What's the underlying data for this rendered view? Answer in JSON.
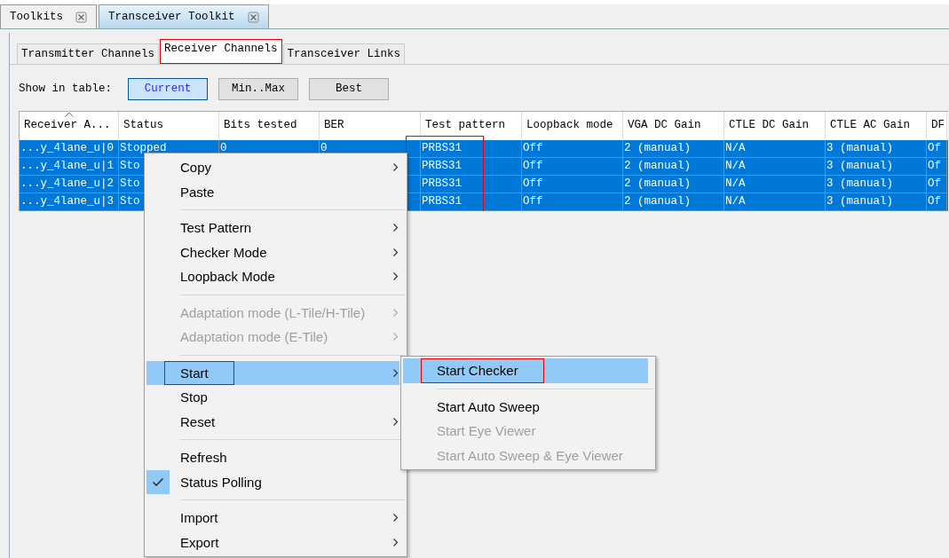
{
  "window_tabs": [
    {
      "label": "Toolkits",
      "selected": false
    },
    {
      "label": "Transceiver Toolkit",
      "selected": true
    }
  ],
  "tabs": [
    {
      "label": "Transmitter Channels",
      "selected": false,
      "annotated": false
    },
    {
      "label": "Receiver Channels",
      "selected": true,
      "annotated": true
    },
    {
      "label": "Transceiver Links",
      "selected": false,
      "annotated": false
    }
  ],
  "show_in_table": {
    "label": "Show in table:",
    "buttons": [
      {
        "label": "Current",
        "selected": true
      },
      {
        "label": "Min..Max",
        "selected": false
      },
      {
        "label": "Best",
        "selected": false
      }
    ]
  },
  "table": {
    "columns": [
      {
        "label": "Receiver A...",
        "sorted": true,
        "annotated": false
      },
      {
        "label": "Status",
        "sorted": false,
        "annotated": false
      },
      {
        "label": "Bits tested",
        "sorted": false,
        "annotated": false
      },
      {
        "label": "BER",
        "sorted": false,
        "annotated": false
      },
      {
        "label": "Test pattern",
        "sorted": false,
        "annotated": true
      },
      {
        "label": "Loopback mode",
        "sorted": false,
        "annotated": false
      },
      {
        "label": "VGA DC Gain",
        "sorted": false,
        "annotated": false
      },
      {
        "label": "CTLE DC Gain",
        "sorted": false,
        "annotated": false
      },
      {
        "label": "CTLE AC Gain",
        "sorted": false,
        "annotated": false
      },
      {
        "label": "DF",
        "sorted": false,
        "annotated": false
      }
    ],
    "rows": [
      {
        "selected": true,
        "cells": [
          "...y_4lane_u|0",
          "Stopped",
          "0",
          "0",
          "PRBS31",
          "Off",
          "2 (manual)",
          "N/A",
          "3 (manual)",
          "Of"
        ]
      },
      {
        "selected": true,
        "cells": [
          "...y_4lane_u|1",
          "Sto",
          null,
          null,
          "PRBS31",
          "Off",
          "2 (manual)",
          "N/A",
          "3 (manual)",
          "Of"
        ]
      },
      {
        "selected": true,
        "cells": [
          "...y_4lane_u|2",
          "Sto",
          null,
          null,
          "PRBS31",
          "Off",
          "2 (manual)",
          "N/A",
          "3 (manual)",
          "Of"
        ]
      },
      {
        "selected": true,
        "cells": [
          "...y_4lane_u|3",
          "Sto",
          null,
          null,
          "PRBS31",
          "Off",
          "2 (manual)",
          "N/A",
          "3 (manual)",
          "Of"
        ]
      }
    ]
  },
  "context_menu": {
    "items": [
      {
        "kind": "item",
        "label": "Copy",
        "submenu": true,
        "disabled": false,
        "checked": false,
        "selected": false,
        "annotated": false
      },
      {
        "kind": "item",
        "label": "Paste",
        "submenu": false,
        "disabled": false,
        "checked": false,
        "selected": false,
        "annotated": false
      },
      {
        "kind": "separator"
      },
      {
        "kind": "item",
        "label": "Test Pattern",
        "submenu": true,
        "disabled": false,
        "checked": false,
        "selected": false,
        "annotated": false
      },
      {
        "kind": "item",
        "label": "Checker Mode",
        "submenu": true,
        "disabled": false,
        "checked": false,
        "selected": false,
        "annotated": false
      },
      {
        "kind": "item",
        "label": "Loopback Mode",
        "submenu": true,
        "disabled": false,
        "checked": false,
        "selected": false,
        "annotated": false
      },
      {
        "kind": "separator"
      },
      {
        "kind": "item",
        "label": "Adaptation mode (L-Tile/H-Tile)",
        "submenu": true,
        "disabled": true,
        "checked": false,
        "selected": false,
        "annotated": false
      },
      {
        "kind": "item",
        "label": "Adaptation mode (E-Tile)",
        "submenu": true,
        "disabled": true,
        "checked": false,
        "selected": false,
        "annotated": false
      },
      {
        "kind": "separator"
      },
      {
        "kind": "item",
        "label": "Start",
        "submenu": true,
        "disabled": false,
        "checked": false,
        "selected": true,
        "annotated": true
      },
      {
        "kind": "item",
        "label": "Stop",
        "submenu": false,
        "disabled": false,
        "checked": false,
        "selected": false,
        "annotated": false
      },
      {
        "kind": "item",
        "label": "Reset",
        "submenu": true,
        "disabled": false,
        "checked": false,
        "selected": false,
        "annotated": false
      },
      {
        "kind": "separator"
      },
      {
        "kind": "item",
        "label": "Refresh",
        "submenu": false,
        "disabled": false,
        "checked": false,
        "selected": false,
        "annotated": false
      },
      {
        "kind": "item",
        "label": "Status Polling",
        "submenu": false,
        "disabled": false,
        "checked": true,
        "selected": false,
        "annotated": false
      },
      {
        "kind": "separator"
      },
      {
        "kind": "item",
        "label": "Import",
        "submenu": true,
        "disabled": false,
        "checked": false,
        "selected": false,
        "annotated": false
      },
      {
        "kind": "item",
        "label": "Export",
        "submenu": true,
        "disabled": false,
        "checked": false,
        "selected": false,
        "annotated": false
      }
    ]
  },
  "submenu": {
    "items": [
      {
        "kind": "item",
        "label": "Start Checker",
        "submenu": false,
        "disabled": false,
        "checked": false,
        "selected": true,
        "annotated": true
      },
      {
        "kind": "separator"
      },
      {
        "kind": "item",
        "label": "Start Auto Sweep",
        "submenu": false,
        "disabled": false,
        "checked": false,
        "selected": false,
        "annotated": false
      },
      {
        "kind": "item",
        "label": "Start Eye Viewer",
        "submenu": false,
        "disabled": true,
        "checked": false,
        "selected": false,
        "annotated": false
      },
      {
        "kind": "item",
        "label": "Start Auto Sweep & Eye Viewer",
        "submenu": false,
        "disabled": true,
        "checked": false,
        "selected": false,
        "annotated": false
      }
    ]
  }
}
